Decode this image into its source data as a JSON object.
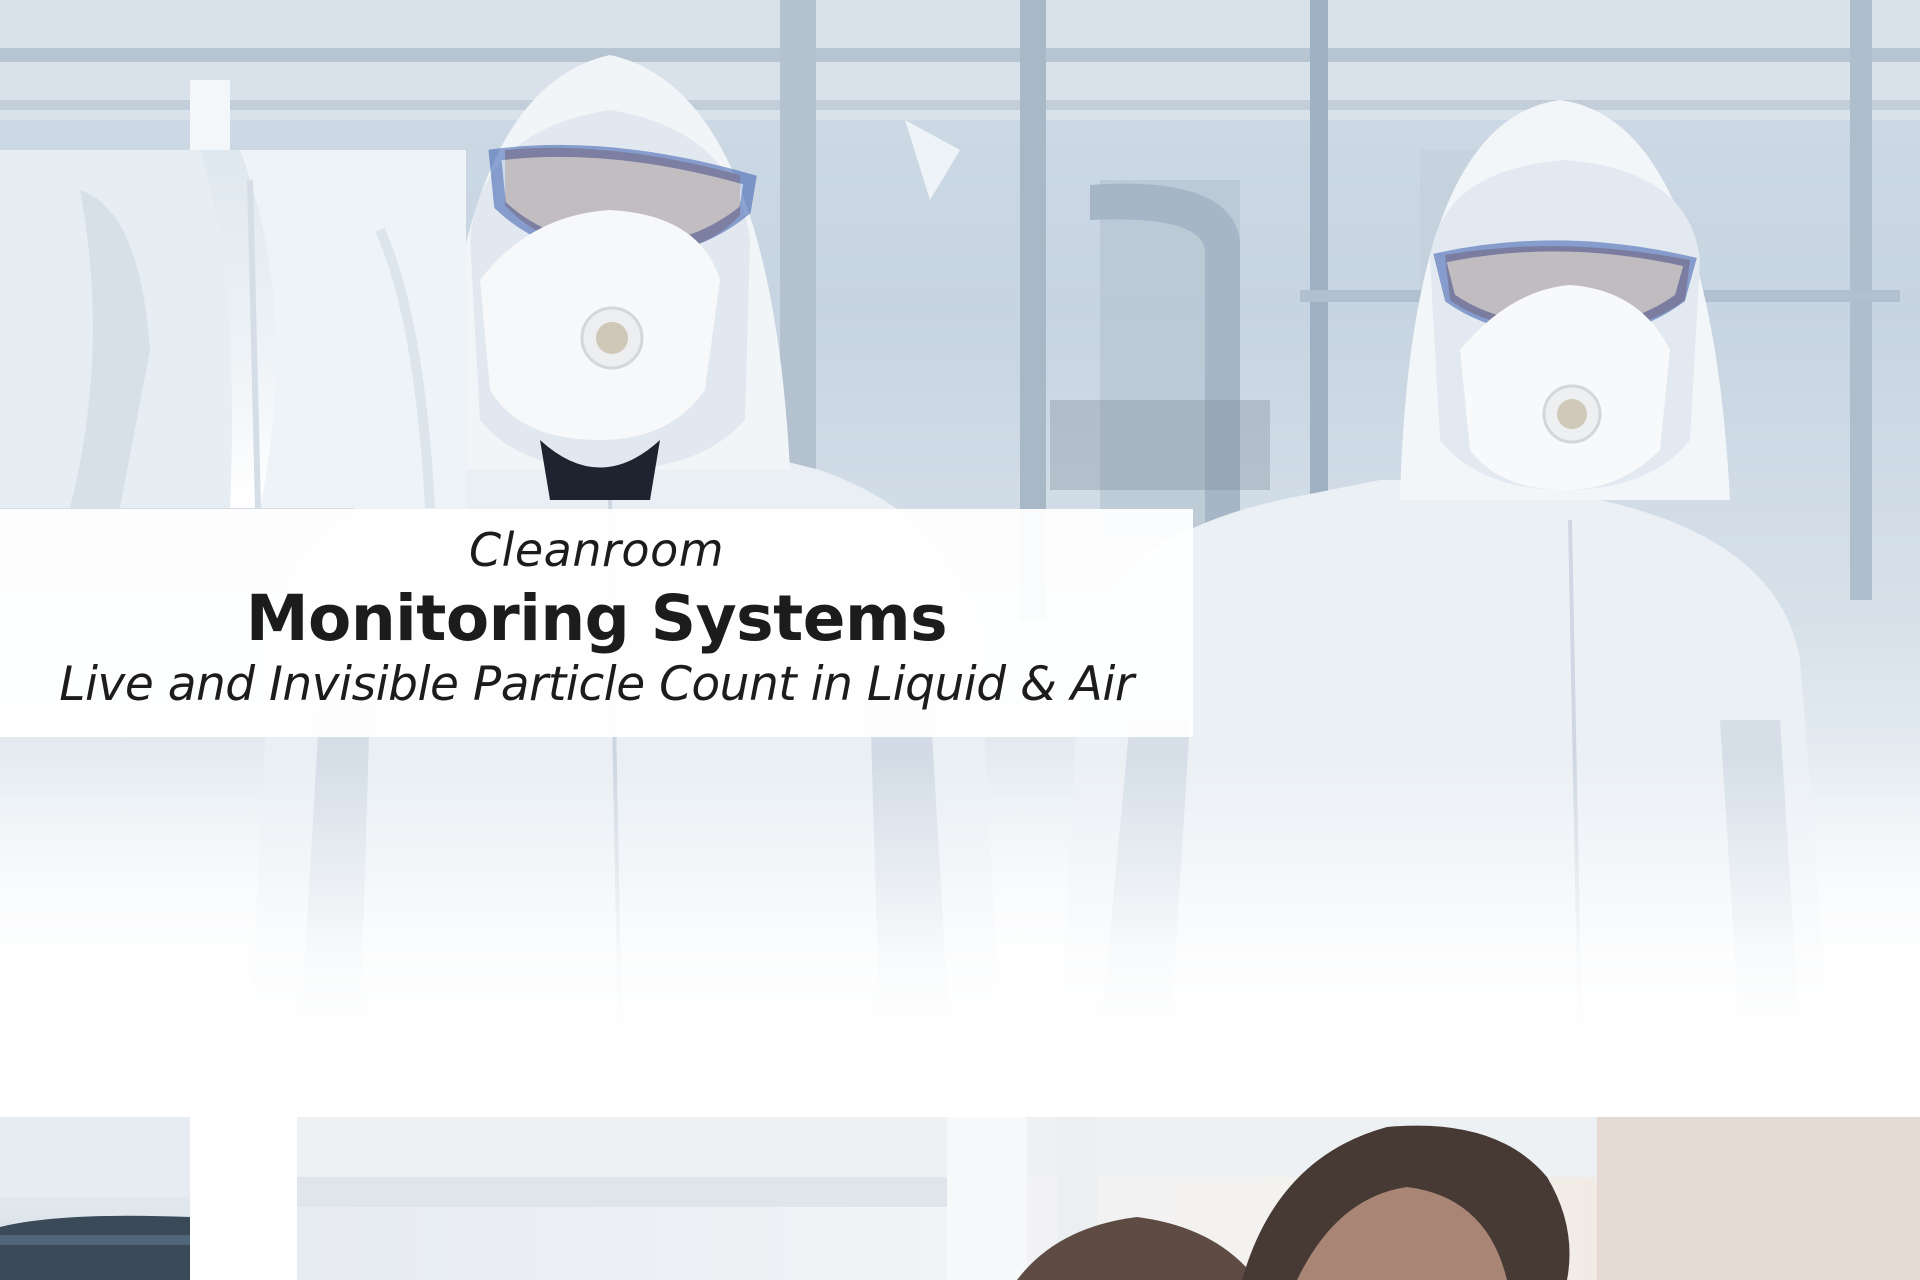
{
  "banner": {
    "kicker": "Cleanroom",
    "headline": "Monitoring Systems",
    "tagline": "Live and Invisible Particle Count in Liquid & Air"
  },
  "colors": {
    "text": "#1c1c1c",
    "card_background": "#ffffff",
    "suit_white": "#f3f6f9",
    "goggle_blue": "#3a5fb0",
    "facility_steel": "#aab8c6"
  }
}
